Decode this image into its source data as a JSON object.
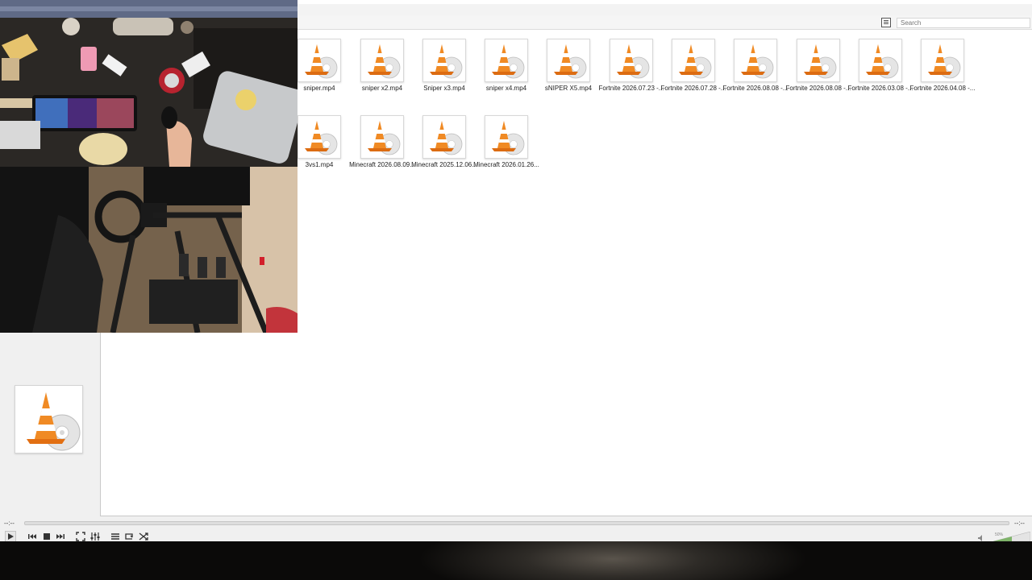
{
  "library": {
    "search_placeholder": "Search",
    "items": [
      {
        "label": "sniper.mp4"
      },
      {
        "label": "sniper x2.mp4"
      },
      {
        "label": "Sniper x3.mp4"
      },
      {
        "label": "sniper x4.mp4"
      },
      {
        "label": "sNIPER X5.mp4"
      },
      {
        "label": "Fortnite 2026.07.23 -..."
      },
      {
        "label": "Fortnite 2026.07.28 -..."
      },
      {
        "label": "Fortnite 2026.08.08 -..."
      },
      {
        "label": "Fortnite 2026.08.08 -..."
      },
      {
        "label": "Fortnite 2026.03.08 -..."
      },
      {
        "label": "Fortnite 2026.04.08 -..."
      },
      {
        "label": "3vs1.mp4"
      },
      {
        "label": "Minecraft 2026.08.09..."
      },
      {
        "label": "Minecraft 2025.12.06..."
      },
      {
        "label": "Minecraft 2026.01.26..."
      }
    ]
  },
  "player": {
    "elapsed": "--:--",
    "remaining": "--:--",
    "volume_percent": 50,
    "volume_label": "50%"
  },
  "icons": {
    "media": "vlc-cone-icon"
  },
  "colors": {
    "cone_orange": "#f08a24",
    "panel_bg": "#f0f0f0"
  }
}
